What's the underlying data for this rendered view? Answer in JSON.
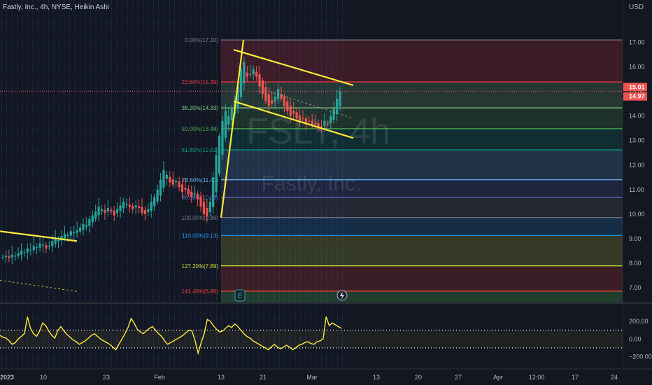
{
  "header": {
    "symbol_line": "Fastly, Inc., 4h, NYSE, Heikin Ashi",
    "currency": "USD"
  },
  "watermark": {
    "ticker": "FSLY, 4h",
    "company": "Fastly, Inc."
  },
  "colors": {
    "background": "#131722",
    "up": "#26a69a",
    "down": "#ef5350",
    "trend_line": "#ffeb3b",
    "oscillator": "#ffeb3b",
    "grid_stripe": "#2962ff"
  },
  "chart_data": [
    {
      "type": "candlestick",
      "title": "Fastly, Inc., 4h, NYSE, Heikin Ashi",
      "ylabel": "USD",
      "ylim": [
        6.4,
        18.1
      ],
      "y_ticks": [
        "17.00",
        "16.00",
        "15.00",
        "14.00",
        "13.00",
        "12.00",
        "11.00",
        "10.00",
        "9.00",
        "8.00",
        "7.00"
      ],
      "x_ticks": [
        "2023",
        "10",
        "23",
        "Feb",
        "13",
        "21",
        "Mar",
        "13",
        "20",
        "27",
        "Apr",
        "12:00",
        "17",
        "24"
      ],
      "price_labels": [
        {
          "text": "15.01",
          "value": 15.01,
          "color": "#ef5350"
        },
        {
          "text": "14.97",
          "value": 14.97,
          "color": "#ef5350"
        }
      ],
      "fibonacci": [
        {
          "label": "0.00%(17.10)",
          "value": 17.1,
          "color": "#787b86"
        },
        {
          "label": "23.60%(15.39)",
          "value": 15.39,
          "color": "#f23645"
        },
        {
          "label": "38.20%(14.33)",
          "value": 14.33,
          "color": "#81c784"
        },
        {
          "label": "50.00%(13.48)",
          "value": 13.48,
          "color": "#4caf50"
        },
        {
          "label": "61.80%(12.62)",
          "value": 12.62,
          "color": "#089981"
        },
        {
          "label": "78.60%(11.40)",
          "value": 11.4,
          "color": "#64b5f6"
        },
        {
          "label": "88.60%(10.68)",
          "value": 10.68,
          "color": "#5c6bc0"
        },
        {
          "label": "100.00%(9.86)",
          "value": 9.86,
          "color": "#787b86"
        },
        {
          "label": "110.00%(9.13)",
          "value": 9.13,
          "color": "#2196f3"
        },
        {
          "label": "127.20%(7.89)",
          "value": 7.89,
          "color": "#cddc39"
        },
        {
          "label": "141.40%(6.86)",
          "value": 6.86,
          "color": "#f44336"
        }
      ],
      "candles_close": [
        8.25,
        8.3,
        8.2,
        8.35,
        8.3,
        8.4,
        8.5,
        8.45,
        8.6,
        8.55,
        8.7,
        8.65,
        8.8,
        8.75,
        8.6,
        8.7,
        8.9,
        9.0,
        8.95,
        9.1,
        9.2,
        9.15,
        9.3,
        9.25,
        9.35,
        9.45,
        9.6,
        9.55,
        9.8,
        9.95,
        10.1,
        10.3,
        10.2,
        10.05,
        10.25,
        10.1,
        9.95,
        10.2,
        10.35,
        10.5,
        10.4,
        10.3,
        10.2,
        10.35,
        10.25,
        10.05,
        10.0,
        10.2,
        10.5,
        10.7,
        11.0,
        11.4,
        11.8,
        11.6,
        11.3,
        11.2,
        11.35,
        11.1,
        10.9,
        11.0,
        10.8,
        10.7,
        10.85,
        10.6,
        10.3,
        10.0,
        9.9,
        10.5,
        11.5,
        12.4,
        13.2,
        13.8,
        14.2,
        14.0,
        14.3,
        14.6,
        15.2,
        15.9,
        16.2,
        15.6,
        15.7,
        15.9,
        15.6,
        15.2,
        14.9,
        14.6,
        14.4,
        14.5,
        14.8,
        15.1,
        14.7,
        14.4,
        14.2,
        14.0,
        14.1,
        13.9,
        13.8,
        13.9,
        13.7,
        13.8,
        13.6,
        13.7,
        13.5,
        13.6,
        13.8,
        13.7,
        14.0,
        14.3,
        14.7,
        15.01
      ],
      "trend_lines": [
        {
          "from": [
            "2023",
            9.3
          ],
          "to": [
            "Jan 12",
            8.9
          ]
        },
        {
          "from": [
            "Feb 13",
            9.86
          ],
          "to": [
            "Feb 15",
            17.1
          ]
        },
        {
          "from": [
            "Feb 15",
            16.7
          ],
          "to": [
            "Mar 6",
            15.25
          ]
        },
        {
          "from": [
            "Feb 15",
            14.6
          ],
          "to": [
            "Mar 6",
            13.1
          ]
        }
      ],
      "icons": [
        "earnings-icon",
        "flash-icon"
      ]
    },
    {
      "type": "line",
      "series": [
        {
          "values": [
            40,
            20,
            10,
            -20,
            -60,
            -40,
            0,
            30,
            60,
            250,
            120,
            60,
            30,
            90,
            180,
            150,
            90,
            40,
            10,
            100,
            140,
            90,
            50,
            20,
            -10,
            -30,
            -60,
            -40,
            -20,
            10,
            40,
            60,
            30,
            0,
            -20,
            -40,
            -60,
            -90,
            -120,
            -60,
            0,
            60,
            130,
            230,
            180,
            110,
            80,
            60,
            90,
            120,
            140,
            100,
            60,
            30,
            -20,
            -60,
            -40,
            -20,
            0,
            20,
            40,
            70,
            100,
            90,
            -20,
            -160,
            -40,
            60,
            220,
            200,
            150,
            110,
            80,
            90,
            120,
            150,
            130,
            170,
            140,
            100,
            60,
            30,
            10,
            -20,
            -40,
            -60,
            -80,
            -100,
            -120,
            -90,
            -60,
            -90,
            -110,
            -90,
            -70,
            -90,
            -120,
            -100,
            -70,
            -60,
            -40,
            -30,
            -50,
            -60,
            -30,
            -20,
            0,
            250,
            150,
            180,
            160,
            140,
            120
          ]
        }
      ],
      "ylim": [
        -320,
        380
      ],
      "y_ticks": [
        "200.00",
        "0.00",
        "−200.00"
      ],
      "reference_levels": [
        100,
        -100
      ]
    }
  ]
}
